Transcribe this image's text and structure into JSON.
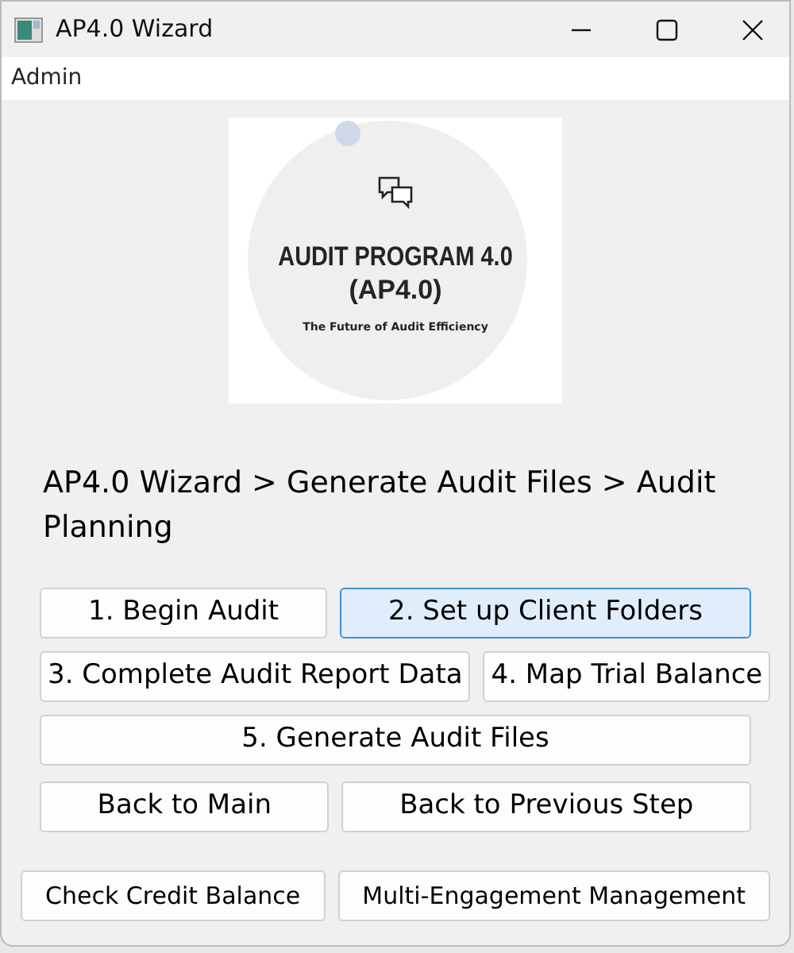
{
  "window": {
    "title": "AP4.0 Wizard"
  },
  "menu": [
    "Admin"
  ],
  "logo": {
    "title": "AUDIT PROGRAM 4.0",
    "subtitle": "(AP4.0)",
    "tagline": "The Future of Audit Efficiency"
  },
  "breadcrumb": "AP4.0 Wizard > Generate Audit Files > Audit Planning",
  "button_rows": [
    [
      {
        "label": "1. Begin Audit",
        "highlighted": false
      },
      {
        "label": "2. Set up Client Folders",
        "highlighted": true
      }
    ],
    [
      {
        "label": "3. Complete Audit Report Data",
        "highlighted": false
      },
      {
        "label": "4. Map Trial Balance",
        "highlighted": false
      }
    ],
    [
      {
        "label": "5. Generate Audit Files",
        "highlighted": false
      }
    ],
    [
      {
        "label": "Back to Main",
        "highlighted": false
      },
      {
        "label": "Back to Previous Step",
        "highlighted": false
      }
    ]
  ],
  "footer_buttons": [
    {
      "label": "Check Credit Balance",
      "highlighted": false
    },
    {
      "label": "Multi-Engagement Management",
      "highlighted": false
    }
  ]
}
